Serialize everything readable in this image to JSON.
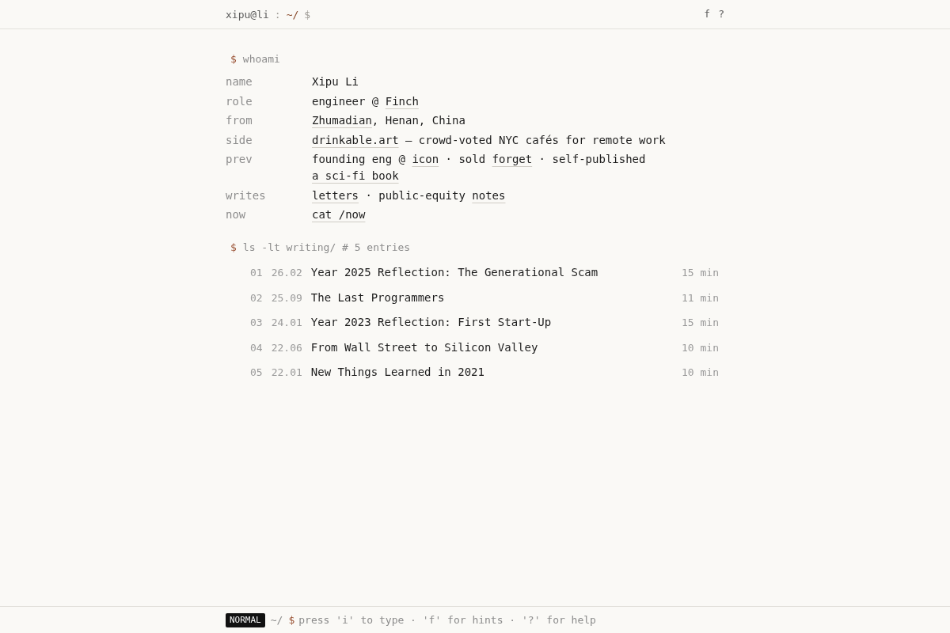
{
  "header": {
    "user": "xipu@li",
    "separator": ":",
    "path": "~/",
    "prompt": "$",
    "keys": [
      "f",
      "?"
    ]
  },
  "whoami": {
    "prompt": "$",
    "command": "whoami",
    "rows": [
      {
        "key": "name",
        "parts": [
          {
            "kind": "text",
            "text": "Xipu Li"
          }
        ]
      },
      {
        "key": "role",
        "parts": [
          {
            "kind": "text",
            "text": "engineer @ "
          },
          {
            "kind": "link",
            "text": "Finch"
          }
        ]
      },
      {
        "key": "from",
        "parts": [
          {
            "kind": "link",
            "text": "Zhumadian"
          },
          {
            "kind": "text",
            "text": ", Henan, China"
          }
        ]
      },
      {
        "key": "side",
        "parts": [
          {
            "kind": "link",
            "text": "drinkable.art"
          },
          {
            "kind": "text",
            "text": " — crowd-voted NYC cafés for remote work"
          }
        ]
      },
      {
        "key": "prev",
        "parts": [
          {
            "kind": "text",
            "text": "founding eng @ "
          },
          {
            "kind": "link",
            "text": "icon"
          },
          {
            "kind": "text",
            "text": " · sold "
          },
          {
            "kind": "link",
            "text": "forget"
          },
          {
            "kind": "text",
            "text": " · self-published "
          },
          {
            "kind": "link",
            "text": "a sci-fi book"
          }
        ]
      },
      {
        "key": "writes",
        "parts": [
          {
            "kind": "link",
            "text": "letters"
          },
          {
            "kind": "text",
            "text": " · public-equity "
          },
          {
            "kind": "link",
            "text": "notes"
          }
        ]
      },
      {
        "key": "now",
        "parts": [
          {
            "kind": "link",
            "text": "cat /now"
          }
        ]
      }
    ]
  },
  "writing": {
    "prompt": "$",
    "command": "ls -lt writing/ # 5 entries",
    "entries": [
      {
        "number": "01",
        "date": "26.02",
        "title": "Year 2025 Reflection: The Generational Scam",
        "read_time": "15 min"
      },
      {
        "number": "02",
        "date": "25.09",
        "title": "The Last Programmers",
        "read_time": "11 min"
      },
      {
        "number": "03",
        "date": "24.01",
        "title": "Year 2023 Reflection: First Start-Up",
        "read_time": "15 min"
      },
      {
        "number": "04",
        "date": "22.06",
        "title": "From Wall Street to Silicon Valley",
        "read_time": "10 min"
      },
      {
        "number": "05",
        "date": "22.01",
        "title": "New Things Learned in 2021",
        "read_time": "10 min"
      }
    ]
  },
  "status_bar": {
    "mode": "NORMAL",
    "path": "~/",
    "prompt": "$",
    "hint": "press 'i' to type · 'f' for hints · '?' for help"
  }
}
